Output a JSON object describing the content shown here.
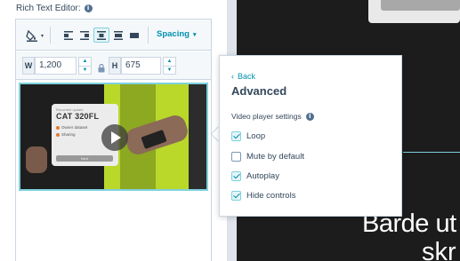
{
  "editor": {
    "title": "Rich Text Editor:",
    "info_icon": "info-icon",
    "toolbar": {
      "spacing_label": "Spacing",
      "spacing_caret": "▾",
      "icons": [
        "fill-color-icon",
        "align-left-icon",
        "align-right-icon",
        "align-center-icon",
        "align-inline-icon",
        "align-full-icon"
      ]
    },
    "size": {
      "width_label": "W",
      "width_value": "1,200",
      "height_label": "H",
      "height_value": "675",
      "lock_icon": "lock-icon"
    },
    "video": {
      "card_small": "Recorded update",
      "card_title": "CAT 320FL",
      "card_row1": "Owner dataset",
      "card_row2": "Sharing",
      "card_button": "Next"
    }
  },
  "popover": {
    "back_label": "Back",
    "back_chevron": "‹",
    "title": "Advanced",
    "section_label": "Video player settings",
    "options": [
      {
        "label": "Loop",
        "checked": true
      },
      {
        "label": "Mute by default",
        "checked": false
      },
      {
        "label": "Autoplay",
        "checked": true
      },
      {
        "label": "Hide controls",
        "checked": true
      }
    ]
  },
  "preview": {
    "line1": "Barde ut",
    "line2": "skr"
  },
  "colors": {
    "accent": "#0091ae",
    "accent_light": "#7fd1de",
    "text": "#33475b",
    "dark_bg": "#1c1c1c"
  }
}
